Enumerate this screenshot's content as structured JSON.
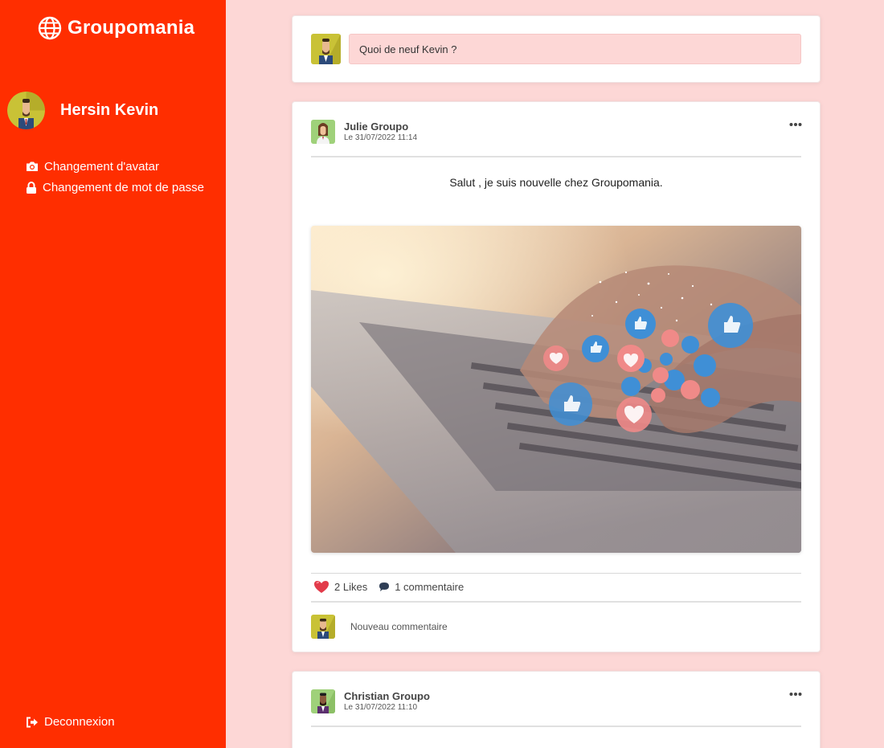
{
  "brand": {
    "name": "Groupomania",
    "icon": "globe-icon"
  },
  "user": {
    "name": "Hersin Kevin"
  },
  "sidebar": {
    "links": [
      {
        "label": "Changement d'avatar",
        "icon": "camera-icon"
      },
      {
        "label": "Changement de mot de passe",
        "icon": "lock-icon"
      }
    ],
    "logout_label": "Deconnexion"
  },
  "composer": {
    "placeholder": "Quoi de neuf Kevin ?"
  },
  "posts": [
    {
      "author": "Julie Groupo",
      "date": "Le 31/07/2022 11:14",
      "text": "Salut , je suis nouvelle chez Groupomania.",
      "likes_label": "2 Likes",
      "comments_label": "1 commentaire",
      "new_comment_placeholder": "Nouveau commentaire"
    },
    {
      "author": "Christian Groupo",
      "date": "Le 31/07/2022 11:10"
    }
  ],
  "colors": {
    "sidebar": "#ff2e00",
    "background": "#fdd7d6",
    "like": "#e23b4a"
  }
}
